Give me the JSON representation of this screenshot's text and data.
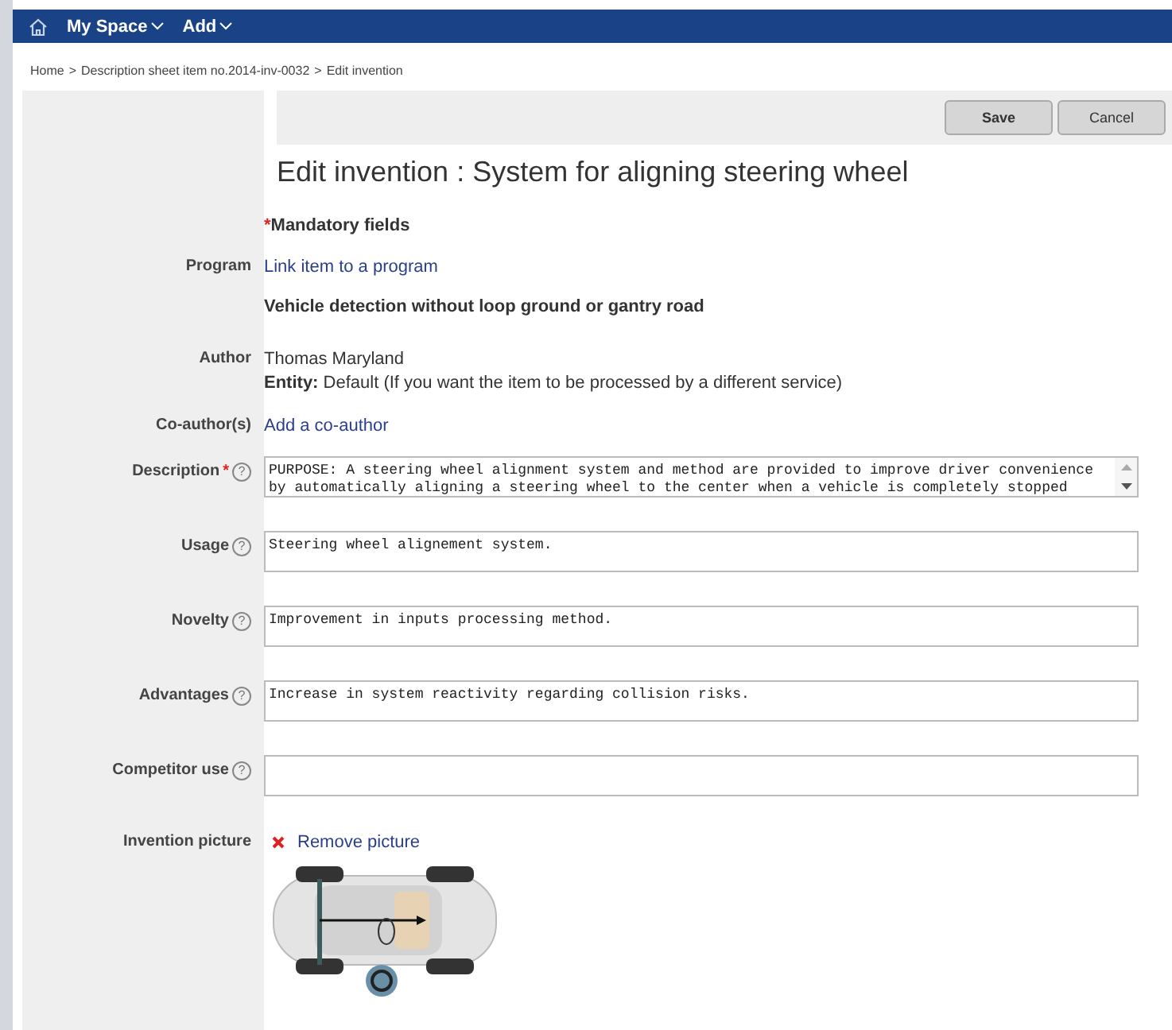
{
  "nav": {
    "items": [
      {
        "label": "My Space"
      },
      {
        "label": "Add"
      }
    ]
  },
  "breadcrumb": [
    "Home",
    "Description sheet item no.2014-inv-0032",
    "Edit invention"
  ],
  "breadcrumb_separator": ">",
  "toolbar": {
    "buttons": [
      "Save",
      "Cancel"
    ]
  },
  "title": "Edit invention  : System for aligning steering wheel",
  "rows": [
    {
      "kind": "note",
      "mark": "*",
      "text": "Mandatory fields"
    },
    {
      "kind": "link",
      "label": "Program",
      "text": "Link item to a program"
    },
    {
      "kind": "bold",
      "text": "Vehicle detection without loop ground or gantry road"
    },
    {
      "kind": "author",
      "label": "Author",
      "name": "Thomas Maryland",
      "entity_label": "Entity:",
      "entity_text": "Default (If you want the item to be processed by a different service)"
    },
    {
      "kind": "link",
      "label": "Co-author(s)",
      "text": "Add a co-author"
    },
    {
      "kind": "field",
      "label": "Description",
      "required_mark": "*",
      "help": "?",
      "scrollbar": true,
      "lines": [
        "PURPOSE: A steering wheel alignment system and method are provided to improve driver convenience",
        "by automatically aligning a steering wheel to the center when a vehicle is completely stopped"
      ]
    },
    {
      "kind": "field",
      "label": "Usage",
      "help": "?",
      "lines": [
        "Steering wheel alignement system."
      ]
    },
    {
      "kind": "field",
      "label": "Novelty",
      "help": "?",
      "lines": [
        "Improvement in inputs processing method."
      ]
    },
    {
      "kind": "field",
      "label": "Advantages",
      "help": "?",
      "lines": [
        "Increase in system reactivity regarding collision risks."
      ]
    },
    {
      "kind": "field",
      "label": "Competitor use",
      "help": "?",
      "lines": []
    },
    {
      "kind": "picture",
      "label": "Invention picture",
      "action": "Remove picture"
    }
  ]
}
